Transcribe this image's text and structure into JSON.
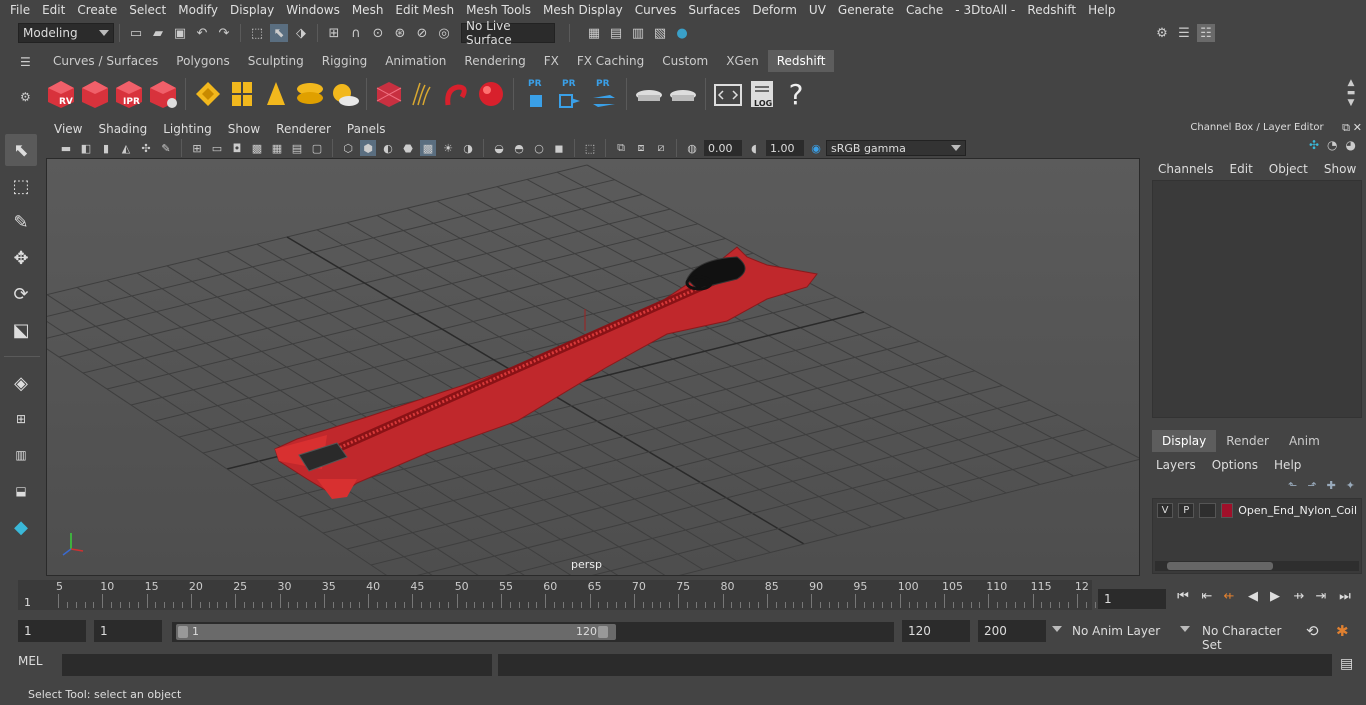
{
  "menubar": [
    "File",
    "Edit",
    "Create",
    "Select",
    "Modify",
    "Display",
    "Windows",
    "Mesh",
    "Edit Mesh",
    "Mesh Tools",
    "Mesh Display",
    "Curves",
    "Surfaces",
    "Deform",
    "UV",
    "Generate",
    "Cache",
    "- 3DtoAll -",
    "Redshift",
    "Help"
  ],
  "statusline": {
    "mode": "Modeling",
    "live_surface": "No Live Surface"
  },
  "shelf": {
    "tabs": [
      "Curves / Surfaces",
      "Polygons",
      "Sculpting",
      "Rigging",
      "Animation",
      "Rendering",
      "FX",
      "FX Caching",
      "Custom",
      "XGen",
      "Redshift"
    ],
    "active_tab": "Redshift",
    "icons": {
      "rv": "RV",
      "ipr": "IPR",
      "pr": "PR",
      "log": "LOG",
      "help": "?"
    }
  },
  "viewport": {
    "menu": [
      "View",
      "Shading",
      "Lighting",
      "Show",
      "Renderer",
      "Panels"
    ],
    "exposure": "0.00",
    "gamma": "1.00",
    "color_space": "sRGB gamma",
    "camera_label": "persp"
  },
  "channelbox": {
    "title": "Channel Box / Layer Editor",
    "menu": [
      "Channels",
      "Edit",
      "Object",
      "Show"
    ],
    "layer_tabs": [
      "Display",
      "Render",
      "Anim"
    ],
    "active_layer_tab": "Display",
    "layer_menu": [
      "Layers",
      "Options",
      "Help"
    ],
    "layer": {
      "v": "V",
      "p": "P",
      "name": "Open_End_Nylon_Coil",
      "color": "#a0102a"
    }
  },
  "timeline": {
    "ticks": [
      "5",
      "10",
      "15",
      "20",
      "25",
      "30",
      "35",
      "40",
      "45",
      "50",
      "55",
      "60",
      "65",
      "70",
      "75",
      "80",
      "85",
      "90",
      "95",
      "100",
      "105",
      "110",
      "115",
      "12"
    ],
    "current_marker": "1",
    "current_frame": "1"
  },
  "range": {
    "start": "1",
    "playback_start": "1",
    "range_start": "1",
    "range_end": "120",
    "playback_end": "120",
    "end": "200",
    "anim_layer": "No Anim Layer",
    "character_set": "No Character Set"
  },
  "cmdline": {
    "label": "MEL"
  },
  "helpline": "Select Tool: select an object"
}
